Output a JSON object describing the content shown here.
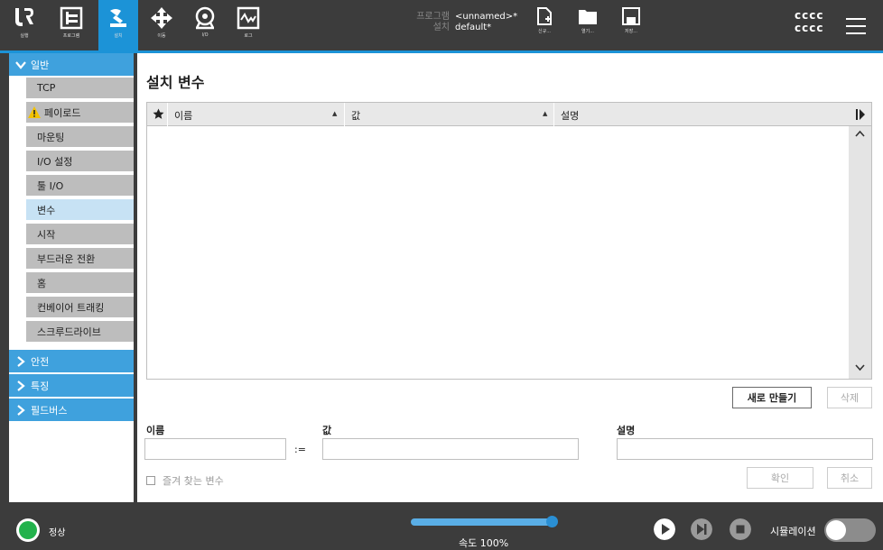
{
  "header": {
    "nav": [
      {
        "label": "실행",
        "icon": "ur-logo-icon"
      },
      {
        "label": "프로그램",
        "icon": "program-icon"
      },
      {
        "label": "설치",
        "icon": "install-icon"
      },
      {
        "label": "이동",
        "icon": "move-icon"
      },
      {
        "label": "I/O",
        "icon": "io-icon"
      },
      {
        "label": "로그",
        "icon": "log-icon"
      }
    ],
    "program_key": "프로그램",
    "program_value": "<unnamed>*",
    "install_key": "설치",
    "install_value": "default*",
    "file_buttons": [
      {
        "label": "신규...",
        "icon": "new-file-icon"
      },
      {
        "label": "열기...",
        "icon": "open-folder-icon"
      },
      {
        "label": "저장...",
        "icon": "save-icon"
      }
    ],
    "robot_name_1": "cccc",
    "robot_name_2": "cccc"
  },
  "sidebar": {
    "sections": [
      {
        "label": "일반",
        "expanded": true
      },
      {
        "label": "안전",
        "expanded": false
      },
      {
        "label": "특징",
        "expanded": false
      },
      {
        "label": "필드버스",
        "expanded": false
      }
    ],
    "items": [
      {
        "label": "TCP"
      },
      {
        "label": "페이로드",
        "warning": true
      },
      {
        "label": "마운팅"
      },
      {
        "label": "I/O 설정"
      },
      {
        "label": "툴 I/O"
      },
      {
        "label": "변수",
        "selected": true
      },
      {
        "label": "시작"
      },
      {
        "label": "부드러운 전환"
      },
      {
        "label": "홈"
      },
      {
        "label": "컨베이어 트래킹"
      },
      {
        "label": "스크루드라이브"
      }
    ]
  },
  "main": {
    "title": "설치 변수",
    "table": {
      "columns": [
        "이름",
        "값",
        "설명"
      ],
      "rows": []
    },
    "new_button": "새로 만들기",
    "delete_button": "삭제",
    "name_label": "이름",
    "value_label": "값",
    "desc_label": "설명",
    "assign_op": ":=",
    "favorite_label": "즐겨 찾는 변수",
    "ok_button": "확인",
    "cancel_button": "취소"
  },
  "footer": {
    "status": "정상",
    "speed": "속도 100%",
    "speed_fraction": 1.0,
    "simulation_label": "시뮬레이션",
    "simulation_on": false
  },
  "colors": {
    "accent": "#1c93d7",
    "sidebar_header": "#3fa1dd",
    "status_ok": "#22b24c"
  }
}
